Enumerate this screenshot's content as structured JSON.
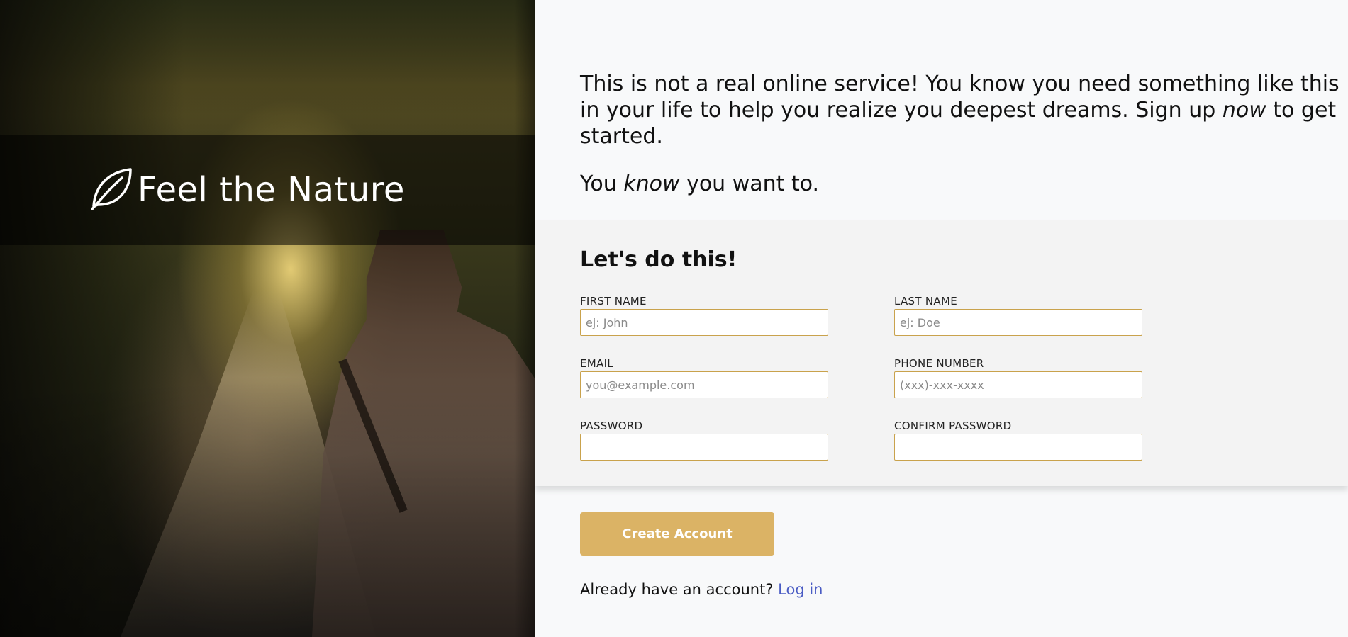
{
  "brand": {
    "icon": "leaf-icon",
    "name": "Feel the Nature"
  },
  "intro": {
    "paragraph1_before": "This is not a real online service! You know you need something like this in your life to help you realize you deepest dreams. Sign up ",
    "paragraph1_emphasis": "now",
    "paragraph1_after": " to get started.",
    "paragraph2_before": "You ",
    "paragraph2_emphasis": "know",
    "paragraph2_after": " you want to."
  },
  "form": {
    "title": "Let's do this!",
    "fields": {
      "first_name": {
        "label": "FIRST NAME",
        "placeholder": "ej: John",
        "value": ""
      },
      "last_name": {
        "label": "LAST NAME",
        "placeholder": "ej: Doe",
        "value": ""
      },
      "email": {
        "label": "EMAIL",
        "placeholder": "you@example.com",
        "value": ""
      },
      "phone": {
        "label": "PHONE NUMBER",
        "placeholder": "(xxx)-xxx-xxxx",
        "value": ""
      },
      "password": {
        "label": "PASSWORD",
        "placeholder": "",
        "value": ""
      },
      "confirm_password": {
        "label": "CONFIRM PASSWORD",
        "placeholder": "",
        "value": ""
      }
    }
  },
  "actions": {
    "create_account_label": "Create Account",
    "login_prompt": "Already have an account? ",
    "login_link": "Log in"
  },
  "colors": {
    "accent": "#dbb365",
    "input_border": "#c9a24c",
    "link": "#4a5cc4",
    "page_background": "#f8f9fa",
    "form_background": "#f3f3f3"
  }
}
